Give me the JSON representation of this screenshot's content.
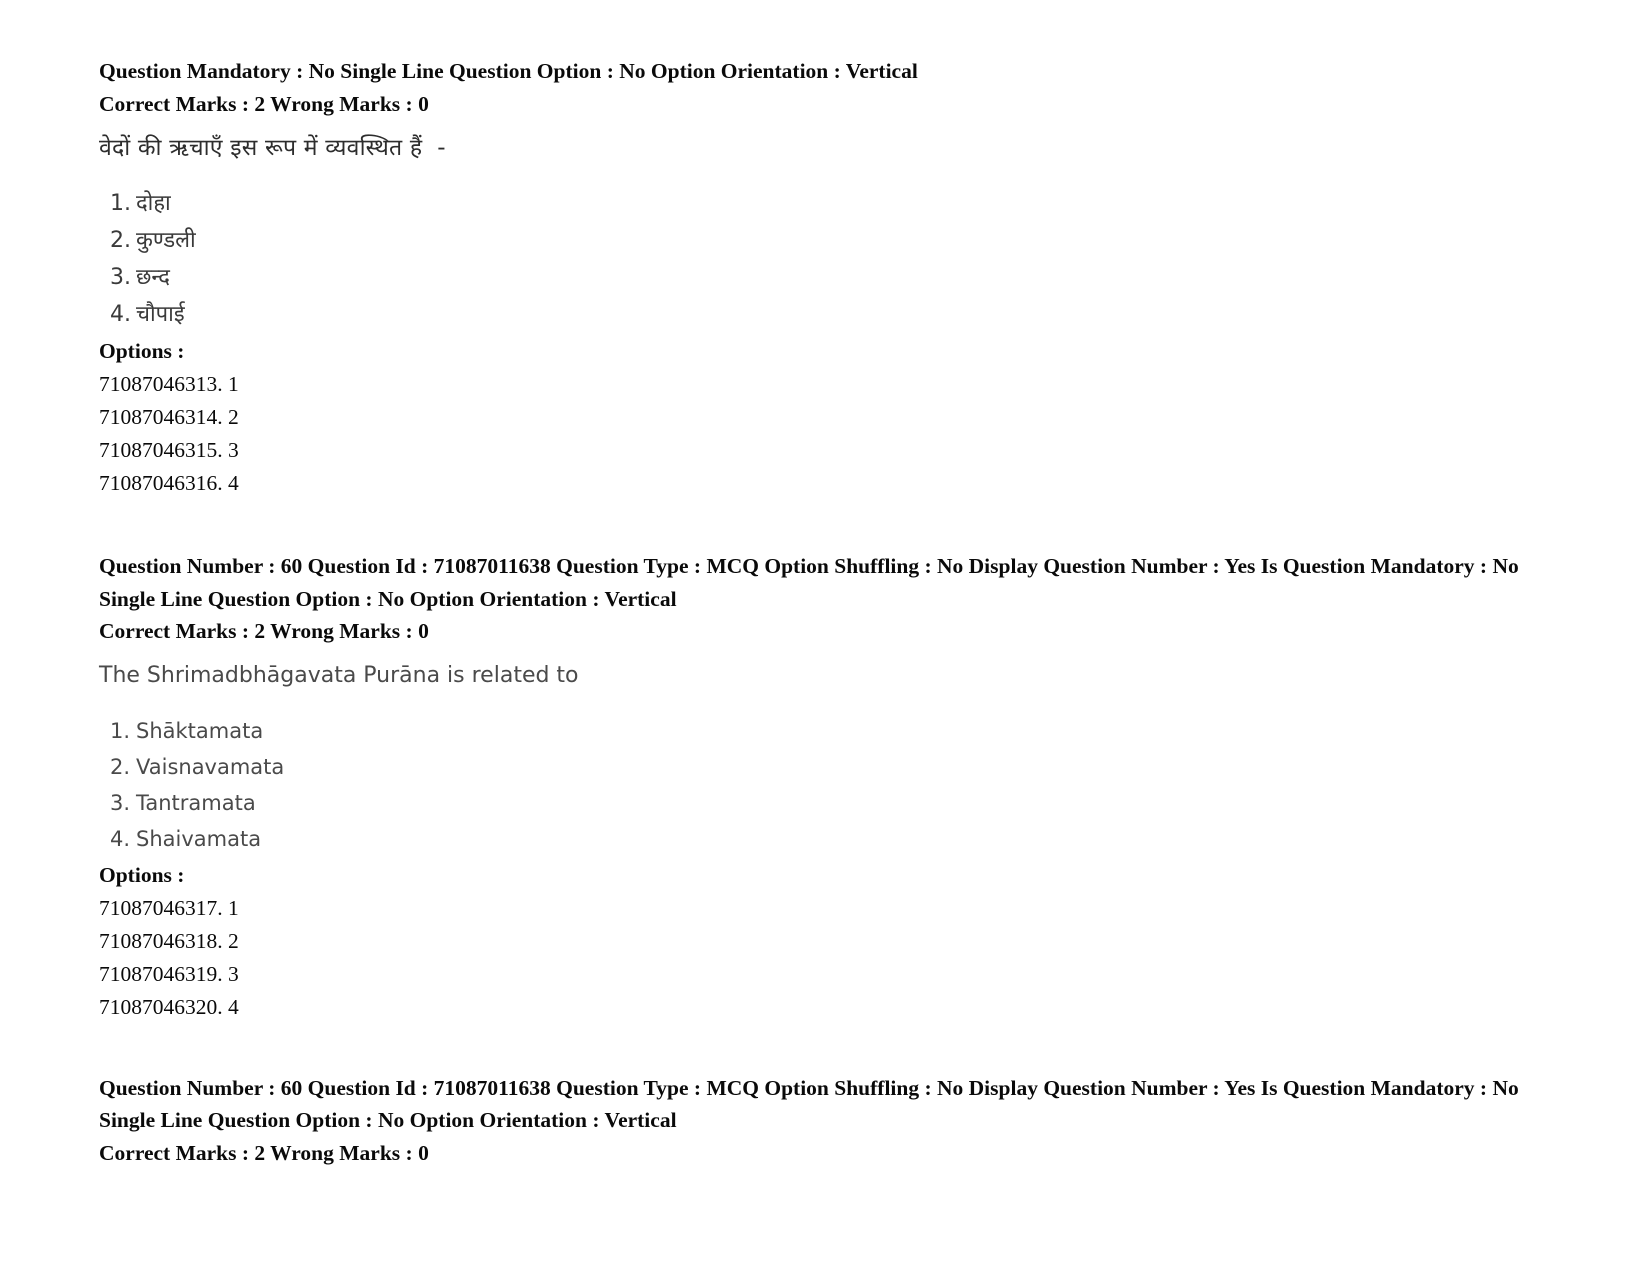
{
  "document": {
    "type": "exam-question-paper",
    "text_color": "#0a0a0a",
    "body_text_color": "#4a4a4a",
    "background": "#ffffff"
  },
  "blocks": [
    {
      "id": "block-1",
      "header_lines": [
        "Question Mandatory : No Single Line Question Option : No Option Orientation : Vertical",
        "Correct Marks : 2 Wrong Marks : 0"
      ],
      "question_text": "वेदों की ऋचाएँ इस रूप में व्यवस्थित हैं  -",
      "script": "devanagari",
      "choices": [
        {
          "number": "1.",
          "text": "दोहा"
        },
        {
          "number": "2.",
          "text": "कुण्डली"
        },
        {
          "number": "3.",
          "text": "छन्द"
        },
        {
          "number": "4.",
          "text": "चौपाई"
        }
      ],
      "options_label": "Options :",
      "option_ids": [
        "71087046313. 1",
        "71087046314. 2",
        "71087046315. 3",
        "71087046316. 4"
      ]
    },
    {
      "id": "block-2",
      "header_lines": [
        "Question Number : 60 Question Id : 71087011638 Question Type : MCQ Option Shuffling : No Display Question Number : Yes Is Question Mandatory : No Single Line Question Option : No Option Orientation : Vertical",
        "Correct Marks : 2 Wrong Marks : 0"
      ],
      "question_text": "The Shrimadbhāgavata Purāna is related to",
      "script": "latin",
      "choices": [
        {
          "number": "1.",
          "text": "Shāktamata"
        },
        {
          "number": "2.",
          "text": "Vaisnavamata"
        },
        {
          "number": "3.",
          "text": "Tantramata"
        },
        {
          "number": "4.",
          "text": "Shaivamata"
        }
      ],
      "options_label": "Options :",
      "option_ids": [
        "71087046317. 1",
        "71087046318. 2",
        "71087046319. 3",
        "71087046320. 4"
      ]
    },
    {
      "id": "block-3",
      "header_lines": [
        "Question Number : 60 Question Id : 71087011638 Question Type : MCQ Option Shuffling : No Display Question Number : Yes Is Question Mandatory : No Single Line Question Option : No Option Orientation : Vertical",
        "Correct Marks : 2 Wrong Marks : 0"
      ],
      "question_text": "",
      "script": "latin",
      "choices": [],
      "options_label": "",
      "option_ids": []
    }
  ]
}
